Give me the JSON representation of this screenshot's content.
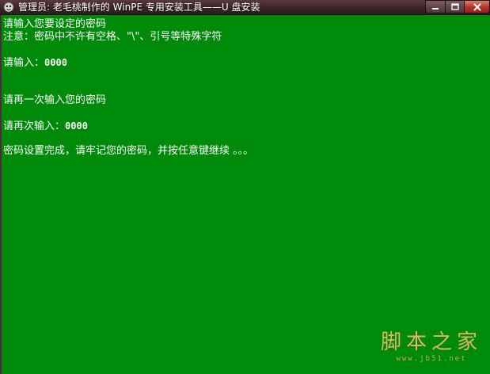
{
  "window": {
    "title": "管理员: 老毛桃制作的 WinPE 专用安装工具——U 盘安装",
    "icon": "console-app-icon",
    "background_color": "#008a09",
    "text_color": "#ffffff"
  },
  "console": {
    "lines": [
      "请输入您要设定的密码",
      "注意：密码中不许有空格、\"\\\"、引号等特殊字符",
      "请输入：",
      "请再一次输入您的密码",
      "请再次输入：",
      "密码设置完成，请牢记您的密码，并按任意键继续 。。。"
    ],
    "first_password": "0000",
    "second_password": "0000"
  },
  "watermark": {
    "name": "脚本之家",
    "url": "www.jb51.net",
    "color": "#f2b968"
  }
}
